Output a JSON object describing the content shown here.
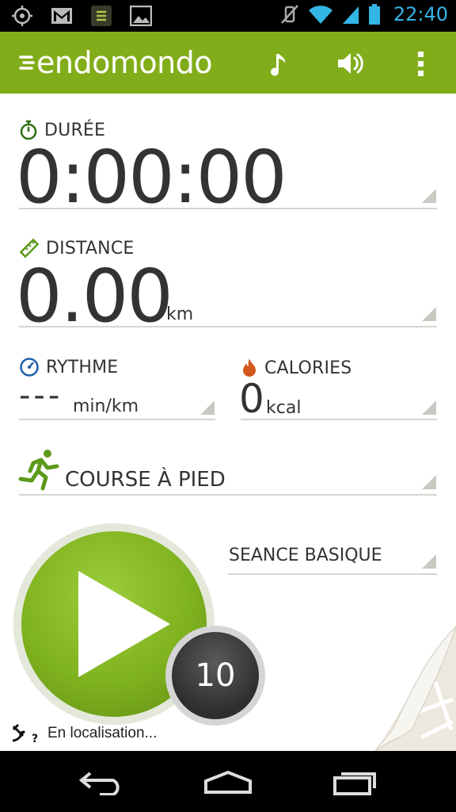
{
  "status_bar": {
    "time": "22:40"
  },
  "app": {
    "logo_text": "endomondo"
  },
  "workout": {
    "duration": {
      "label": "DURÉE",
      "value": "0:00:00"
    },
    "distance": {
      "label": "DISTANCE",
      "value": "0.00",
      "unit": "km"
    },
    "pace": {
      "label": "RYTHME",
      "value": "---",
      "unit": "min/km"
    },
    "calories": {
      "label": "CALORIES",
      "value": "0",
      "unit": "kcal"
    }
  },
  "sport": {
    "label": "COURSE À PIED"
  },
  "program": {
    "label": "SEANCE BASIQUE"
  },
  "countdown": {
    "value": "10"
  },
  "gps": {
    "status": "En localisation..."
  },
  "colors": {
    "accent": "#82ad1a",
    "status_time": "#33b5e5"
  }
}
